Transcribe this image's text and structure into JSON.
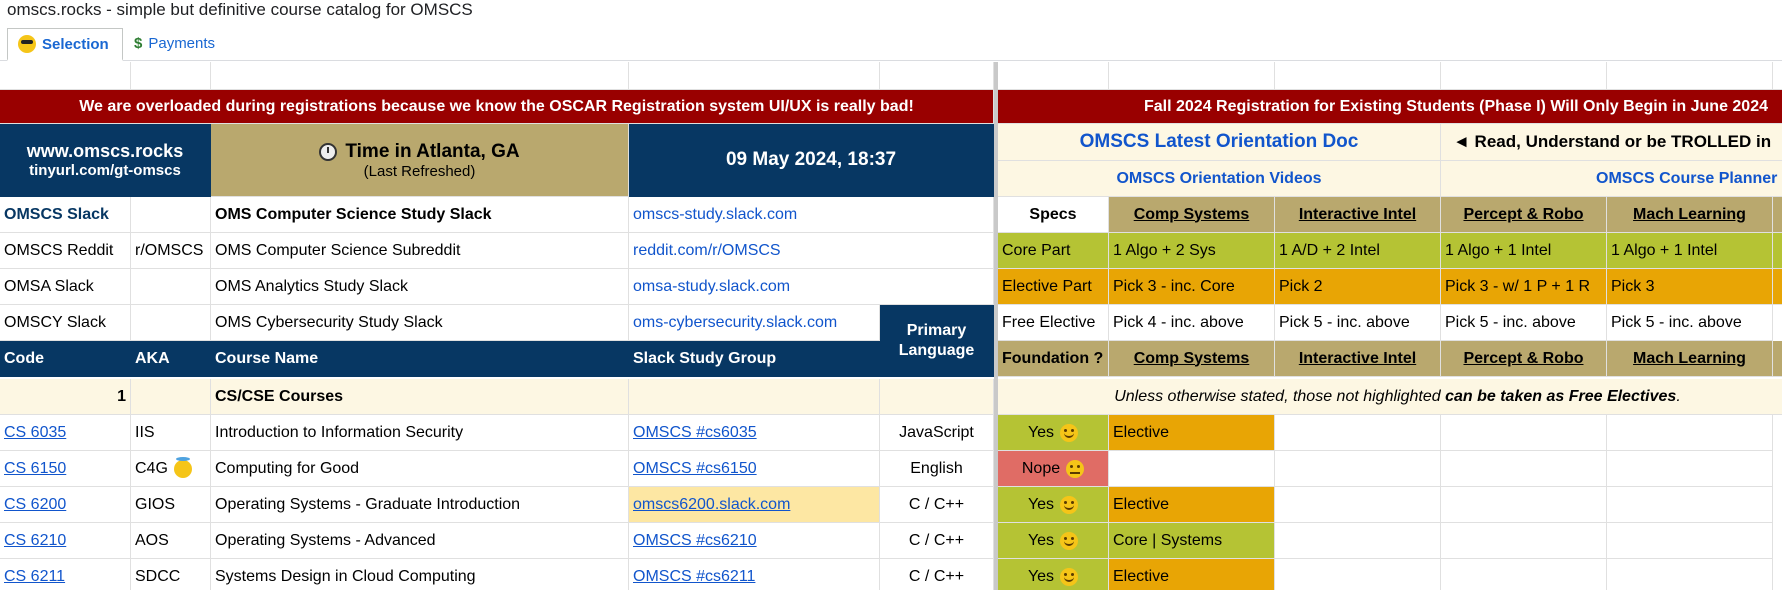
{
  "window_title": "omscs.rocks - simple but definitive course catalog for OMSCS",
  "tabs": [
    {
      "label": "Selection",
      "icon": "sunglasses-emoji-icon"
    },
    {
      "label": "Payments",
      "icon": "dollar-icon"
    }
  ],
  "banners": {
    "left": "We are overloaded during registrations because we know the OSCAR Registration system UI/UX is really bad!",
    "right": "Fall 2024 Registration for Existing Students (Phase I) Will Only Begin in June 2024"
  },
  "header": {
    "site": "www.omscs.rocks",
    "short_url": "tinyurl.com/gt-omscs",
    "time_label": "Time in Atlanta, GA",
    "time_sub": "(Last Refreshed)",
    "datetime": "09 May 2024, 18:37",
    "orientation_doc": "OMSCS Latest Orientation Doc",
    "read_warning": "◄ Read, Understand or be TROLLED in",
    "orientation_videos": "OMSCS Orientation Videos",
    "course_planner": "OMSCS Course Planner"
  },
  "communities": [
    {
      "name": "OMSCS Slack",
      "aka": "",
      "desc": "OMS Computer Science Study Slack",
      "link": "omscs-study.slack.com"
    },
    {
      "name": "OMSCS Reddit",
      "aka": "r/OMSCS",
      "desc": "OMS Computer Science Subreddit",
      "link": "reddit.com/r/OMSCS"
    },
    {
      "name": "OMSA Slack",
      "aka": "",
      "desc": "OMS Analytics Study Slack",
      "link": "omsa-study.slack.com"
    },
    {
      "name": "OMSCY Slack",
      "aka": "",
      "desc": "OMS Cybersecurity Study Slack",
      "link": "oms-cybersecurity.slack.com"
    }
  ],
  "primary_language_header": "Primary Language",
  "columns": {
    "code": "Code",
    "aka": "AKA",
    "name": "Course Name",
    "slack": "Slack Study Group"
  },
  "section": {
    "num": "1",
    "title": "CS/CSE Courses"
  },
  "specs": {
    "header": "Specs",
    "tracks": [
      "Comp Systems",
      "Interactive Intel",
      "Percept & Robo",
      "Mach Learning"
    ],
    "core_label": "Core Part",
    "core": [
      "1 Algo + 2 Sys",
      "1 A/D + 2 Intel",
      "1 Algo + 1 Intel",
      "1 Algo + 1 Intel"
    ],
    "elective_label": "Elective Part",
    "elective": [
      "Pick 3 - inc. Core",
      "Pick 2",
      "Pick 3 - w/ 1 P + 1 R",
      "Pick 3"
    ],
    "free_label": "Free Elective",
    "free": [
      "Pick 4 - inc. above",
      "Pick 5 - inc. above",
      "Pick 5 - inc. above",
      "Pick 5 - inc. above"
    ],
    "foundation_label": "Foundation ?",
    "note_prefix": "Unless otherwise stated, those not highlighted ",
    "note_bold": "can be taken as Free Electives",
    "note_suffix": "."
  },
  "courses": [
    {
      "code": "CS 6035",
      "aka": "IIS",
      "name": "Introduction to Information Security",
      "slack": "OMSCS #cs6035",
      "lang": "JavaScript",
      "foundation": "Yes",
      "comp_systems": "Elective"
    },
    {
      "code": "CS 6150",
      "aka": "C4G",
      "name": "Computing for Good",
      "slack": "OMSCS #cs6150",
      "lang": "English",
      "foundation": "Nope",
      "comp_systems": ""
    },
    {
      "code": "CS 6200",
      "aka": "GIOS",
      "name": "Operating Systems - Graduate Introduction",
      "slack": "omscs6200.slack.com",
      "lang": "C / C++",
      "foundation": "Yes",
      "comp_systems": "Elective"
    },
    {
      "code": "CS 6210",
      "aka": "AOS",
      "name": "Operating Systems - Advanced",
      "slack": "OMSCS #cs6210",
      "lang": "C / C++",
      "foundation": "Yes",
      "comp_systems": "Core | Systems"
    },
    {
      "code": "CS 6211",
      "aka": "SDCC",
      "name": "Systems Design in Cloud Computing",
      "slack": "OMSCS #cs6211",
      "lang": "C / C++",
      "foundation": "Yes",
      "comp_systems": "Elective"
    }
  ],
  "colors": {
    "banner": "#990000",
    "navy": "#073763",
    "khaki": "#b9a86e",
    "green": "#b5c334",
    "orange": "#e8a505",
    "red": "#e06c65"
  }
}
